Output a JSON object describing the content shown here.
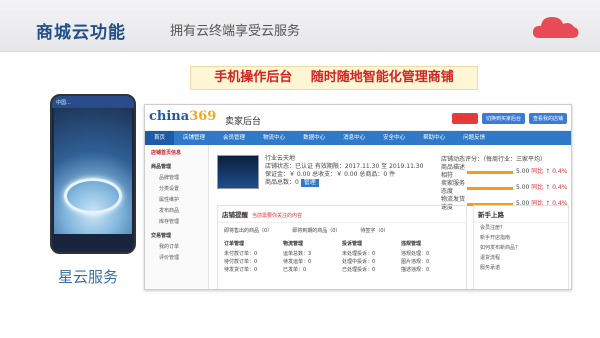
{
  "header": {
    "title": "商城云功能",
    "subtitle": "拥有云终端享受云服务"
  },
  "slogan": {
    "part1": "手机操作后台",
    "part2": "随时随地智能化管理商铺"
  },
  "phone": {
    "status_text": "中国..."
  },
  "caption": "星云服务",
  "dashboard": {
    "logo_text": "china",
    "logo_num": "369",
    "title": "卖家后台",
    "top_buttons": [
      "0条消息",
      "切换到买家后台",
      "查看我的店铺"
    ],
    "nav": [
      "首页",
      "店铺管理",
      "会员管理",
      "物流中心",
      "数据中心",
      "消息中心",
      "安全中心",
      "帮助中心",
      "问题反馈"
    ],
    "sidebar": [
      {
        "label": "店铺首页信息",
        "type": "head"
      },
      {
        "label": "商品管理",
        "type": "group"
      },
      {
        "label": "品牌管理",
        "type": "item"
      },
      {
        "label": "分类设置",
        "type": "item"
      },
      {
        "label": "属性维护",
        "type": "item"
      },
      {
        "label": "发布商品",
        "type": "item"
      },
      {
        "label": "库存管理",
        "type": "item"
      },
      {
        "label": "交易管理",
        "type": "group"
      },
      {
        "label": "我的订单",
        "type": "item"
      },
      {
        "label": "评价管理",
        "type": "item"
      }
    ],
    "shop": {
      "name": "行业云天地",
      "line1": "店铺状态：已认证  有效期限：2017.11.30 至 2019.11.30",
      "line2": "保证金：￥ 0.00  总收支：￥ 0.00  总商品：0 件",
      "line3": "商品总数：0",
      "tag": "管理"
    },
    "score": {
      "title": "店铺动态评分：（每周行业：三家平均）",
      "rows": [
        {
          "label": "商品描述相符",
          "value": "5.00",
          "compare": "同比 ↑ 0.4%"
        },
        {
          "label": "卖家服务态度",
          "value": "5.00",
          "compare": "同比 ↑ 0.4%"
        },
        {
          "label": "物流发货速度",
          "value": "5.00",
          "compare": "同比 ↑ 0.4%"
        }
      ]
    },
    "remind": {
      "title": "店铺提醒",
      "note": "当前需要你关注的内容",
      "items": [
        "即将售出的商品（0）",
        "即将到期的商品（0）",
        "待签字（0）"
      ]
    },
    "columns": [
      {
        "title": "订单管理",
        "rows": [
          "未付款订单：0",
          "待付款订单：0",
          "待发货订单：0"
        ]
      },
      {
        "title": "物流管理",
        "rows": [
          "运单总数：3",
          "待发运单：0",
          "已发单：0"
        ]
      },
      {
        "title": "投诉管理",
        "rows": [
          "未处理投诉：0",
          "处理中投诉：0",
          "已处理投诉：0"
        ]
      },
      {
        "title": "违规管理",
        "rows": [
          "违规处理：0",
          "图片违规：0",
          "描述违规：0"
        ]
      }
    ],
    "novice": {
      "title": "新手上路",
      "items": [
        "会员注册?",
        "新手开店指南",
        "如何发布新商品?",
        "退货流程",
        "服务承诺"
      ]
    }
  }
}
